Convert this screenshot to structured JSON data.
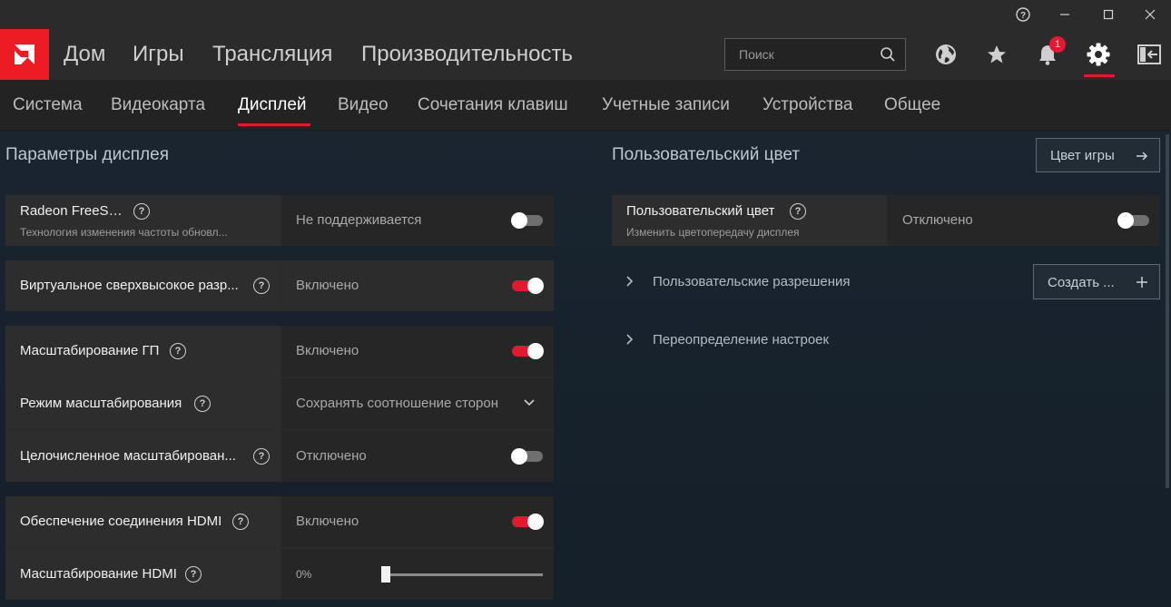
{
  "window": {
    "help_icon": "help-circle-icon",
    "minimize": "—",
    "maximize": "☐",
    "close": "✕"
  },
  "mainnav": {
    "items": [
      "Дом",
      "Игры",
      "Трансляция",
      "Производительность"
    ],
    "search_placeholder": "Поиск",
    "notification_count": "1",
    "accent": "#e2192f"
  },
  "subnav": {
    "items": [
      "Система",
      "Видеокарта",
      "Дисплей",
      "Видео",
      "Сочетания клавиш",
      "Учетные записи",
      "Устройства",
      "Общее"
    ],
    "active": "Дисплей"
  },
  "left": {
    "title": "Параметры дисплея",
    "freesync": {
      "label": "Radeon FreeSync",
      "sub": "Технология изменения частоты обновл...",
      "value": "Не поддерживается",
      "state": "off"
    },
    "vsr": {
      "label": "Виртуальное сверхвысокое разр...",
      "value": "Включено",
      "state": "on"
    },
    "gpu_scaling": {
      "label": "Масштабирование ГП",
      "value": "Включено",
      "state": "on"
    },
    "scaling_mode": {
      "label": "Режим масштабирования",
      "value": "Сохранять соотношение сторон"
    },
    "integer_scaling": {
      "label": "Целочисленное масштабирован...",
      "value": "Отключено",
      "state": "off"
    },
    "hdmi_link": {
      "label": "Обеспечение соединения HDMI",
      "value": "Включено",
      "state": "on"
    },
    "hdmi_scaling": {
      "label": "Масштабирование HDMI",
      "value": "0%",
      "level": 0
    }
  },
  "right": {
    "title": "Пользовательский цвет",
    "game_color_button": "Цвет игры",
    "custom_color": {
      "label": "Пользовательский цвет",
      "sub": "Изменить цветопередачу дисплея",
      "value": "Отключено",
      "state": "off"
    },
    "custom_resolutions": "Пользовательские разрешения",
    "create_button": "Создать ...",
    "overrides": "Переопределение настроек"
  }
}
